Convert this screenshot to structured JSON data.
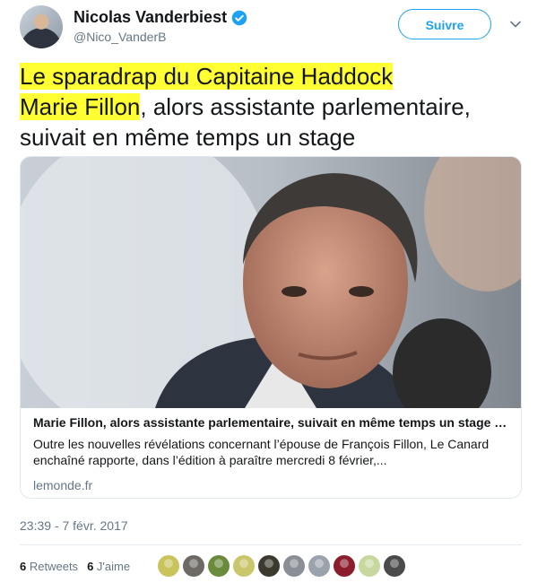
{
  "header": {
    "name": "Nicolas Vanderbiest",
    "handle": "@Nico_VanderB",
    "follow_label": "Suivre"
  },
  "tweet": {
    "line1": "Le sparadrap du Capitaine Haddock",
    "line2_highlight": "Marie Fillon",
    "line2_rest": ", alors assistante parlementaire,",
    "line3": "suivait en même temps un stage"
  },
  "card": {
    "title": "Marie Fillon, alors assistante parlementaire, suivait en même temps un stage …",
    "description": "Outre les nouvelles révélations concernant l’épouse de François Fillon, Le Canard enchaîné rapporte, dans l’édition à paraître mercredi 8 février,...",
    "domain": "lemonde.fr"
  },
  "timestamp": "23:39 - 7 févr. 2017",
  "stats": {
    "retweets_count": "6",
    "retweets_label": "Retweets",
    "likes_count": "6",
    "likes_label": "J'aime"
  },
  "likers": [
    {
      "color": "#c8c35a"
    },
    {
      "color": "#6d6a66"
    },
    {
      "color": "#6a8a3c"
    },
    {
      "color": "#c9c66b"
    },
    {
      "color": "#3c3a2e"
    },
    {
      "color": "#8a8f96"
    },
    {
      "color": "#9aa3ab"
    },
    {
      "color": "#8b1e2c"
    },
    {
      "color": "#c7d89e"
    },
    {
      "color": "#4b4b4b"
    }
  ],
  "colors": {
    "accent": "#1da1f2",
    "highlight": "#ffff33",
    "muted": "#657786"
  }
}
